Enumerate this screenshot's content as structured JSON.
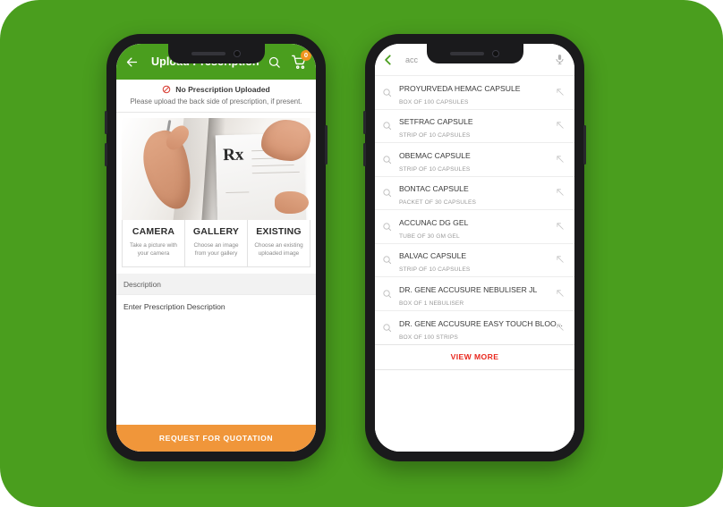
{
  "theme": {
    "background_green": "#4a9e1e",
    "appbar_green": "#4a9e1e",
    "cta_orange": "#f0963a",
    "badge_orange": "#f0941f",
    "viewmore_red": "#e8261c",
    "notice_red": "#d7372c"
  },
  "phone_left": {
    "appbar": {
      "back_icon": "arrow-left-icon",
      "title": "Upload Prescription",
      "search_icon": "search-icon",
      "cart_icon": "cart-icon",
      "cart_badge": "0"
    },
    "notice": {
      "icon": "no-entry-icon",
      "title": "No Prescription Uploaded",
      "subtitle": "Please upload the back side of prescription, if present."
    },
    "photo": {
      "rx_symbol": "Rx",
      "alt": "doctor-holding-prescription-photo"
    },
    "sources": [
      {
        "title": "CAMERA",
        "subtitle": "Take a picture with your camera"
      },
      {
        "title": "GALLERY",
        "subtitle": "Choose an image from your gallery"
      },
      {
        "title": "EXISTING",
        "subtitle": "Choose an existing uploaded image"
      }
    ],
    "description": {
      "label": "Description",
      "placeholder": "Enter Prescription Description",
      "value": ""
    },
    "cta_label": "REQUEST FOR QUOTATION"
  },
  "phone_right": {
    "searchbar": {
      "back_icon": "chevron-left-icon",
      "value": "acc",
      "mic_icon": "microphone-icon"
    },
    "results": [
      {
        "name": "PROYURVEDA HEMAC CAPSULE",
        "pack": "BOX OF 100 CAPSULES"
      },
      {
        "name": "SETFRAC CAPSULE",
        "pack": "STRIP OF 10 CAPSULES"
      },
      {
        "name": "OBEMAC CAPSULE",
        "pack": "STRIP OF 10 CAPSULES"
      },
      {
        "name": "BONTAC CAPSULE",
        "pack": "PACKET OF 30 CAPSULES"
      },
      {
        "name": "ACCUNAC DG GEL",
        "pack": "TUBE OF 30 GM GEL"
      },
      {
        "name": "BALVAC CAPSULE",
        "pack": "STRIP OF 10 CAPSULES"
      },
      {
        "name": "DR. GENE ACCUSURE NEBULISER JL",
        "pack": "BOX OF 1 NEBULISER"
      },
      {
        "name": "DR. GENE ACCUSURE EASY TOUCH BLOO...",
        "pack": "BOX OF 100 STRIPS"
      }
    ],
    "view_more_label": "VIEW MORE"
  }
}
